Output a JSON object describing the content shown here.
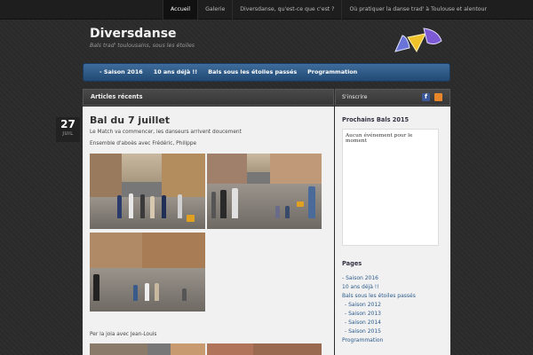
{
  "topnav": {
    "items": [
      {
        "label": "Accueil",
        "active": true
      },
      {
        "label": "Galerie"
      },
      {
        "label": "Diversdanse, qu'est-ce que c'est ?"
      },
      {
        "label": "Où pratiquer la danse trad' à Toulouse et alentour"
      }
    ]
  },
  "header": {
    "title": "Diversdanse",
    "tagline": "Bals trad' toulousains, sous les étoiles"
  },
  "mainnav": {
    "items": [
      "- Saison 2016",
      "10 ans déjà !!",
      "Bals sous les étoiles passés",
      "Programmation"
    ]
  },
  "content": {
    "section_title": "Articles récents",
    "post": {
      "day": "27",
      "month": "JUIL",
      "title": "Bal du 7 juillet",
      "line1": "Le Match va commencer, les danseurs arrivent doucement",
      "line2": "Ensemble d'aboès avec Frédéric, Philippe",
      "line3": "Per la joia avec Jean-Louis"
    }
  },
  "sidebar": {
    "header_label": "S'inscrire",
    "events_title": "Prochains Bals 2015",
    "events_empty": "Aucun événement pour le moment",
    "pages_title": "Pages",
    "pages": [
      "- Saison 2016",
      "10 ans déjà !!",
      "Bals sous les étoiles passés",
      "- Saison 2012",
      "- Saison 2013",
      "- Saison 2014",
      "- Saison 2015",
      "Programmation"
    ]
  },
  "colors": {
    "nav_blue": "#2c5a88",
    "background": "#2b2b2b",
    "content_bg": "#f1f1f1",
    "link": "#2b5a8c"
  },
  "icons": [
    "facebook-icon",
    "rss-icon"
  ]
}
